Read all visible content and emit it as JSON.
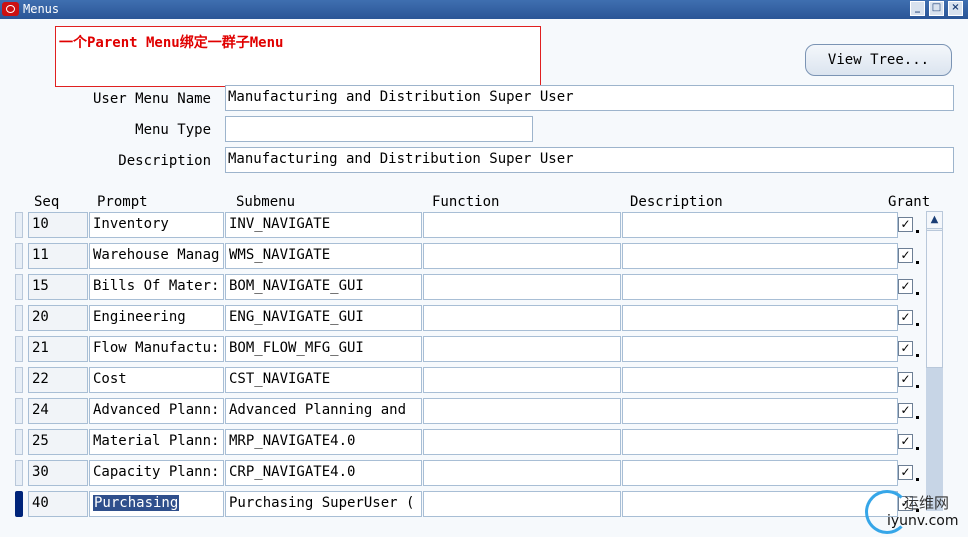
{
  "window": {
    "title": "Menus"
  },
  "note": {
    "text": "一个Parent Menu绑定一群子Menu"
  },
  "view_tree_label": "View Tree...",
  "form": {
    "user_menu_name_label": "User Menu Name",
    "user_menu_name_value": "Manufacturing and Distribution Super User",
    "menu_type_label": "Menu Type",
    "menu_type_value": "",
    "description_label": "Description",
    "description_value": "Manufacturing and Distribution Super User"
  },
  "table": {
    "headers": {
      "seq": "Seq",
      "prompt": "Prompt",
      "submenu": "Submenu",
      "function": "Function",
      "description": "Description",
      "grant": "Grant"
    },
    "rows": [
      {
        "seq": "10",
        "prompt": "Inventory",
        "submenu": "INV_NAVIGATE",
        "function": "",
        "description": "",
        "grant": true
      },
      {
        "seq": "11",
        "prompt": "Warehouse Manag",
        "submenu": "WMS_NAVIGATE",
        "function": "",
        "description": "",
        "grant": true
      },
      {
        "seq": "15",
        "prompt": "Bills Of Mater:",
        "submenu": "BOM_NAVIGATE_GUI",
        "function": "",
        "description": "",
        "grant": true
      },
      {
        "seq": "20",
        "prompt": "Engineering",
        "submenu": "ENG_NAVIGATE_GUI",
        "function": "",
        "description": "",
        "grant": true
      },
      {
        "seq": "21",
        "prompt": "Flow Manufactu:",
        "submenu": "BOM_FLOW_MFG_GUI",
        "function": "",
        "description": "",
        "grant": true
      },
      {
        "seq": "22",
        "prompt": "Cost",
        "submenu": "CST_NAVIGATE",
        "function": "",
        "description": "",
        "grant": true
      },
      {
        "seq": "24",
        "prompt": "Advanced Plann:",
        "submenu": "Advanced Planning and",
        "function": "",
        "description": "",
        "grant": true
      },
      {
        "seq": "25",
        "prompt": "Material Plann:",
        "submenu": "MRP_NAVIGATE4.0",
        "function": "",
        "description": "",
        "grant": true
      },
      {
        "seq": "30",
        "prompt": "Capacity Plann:",
        "submenu": "CRP_NAVIGATE4.0",
        "function": "",
        "description": "",
        "grant": true
      },
      {
        "seq": "40",
        "prompt": "Purchasing",
        "submenu": "Purchasing SuperUser (",
        "function": "",
        "description": "",
        "grant": true
      }
    ]
  },
  "watermark": {
    "cn": "运维网",
    "url": "iyunv.com"
  },
  "icons": {
    "app": "oracle-logo-icon",
    "check": "check-icon"
  },
  "colors": {
    "titlebar": "#2a5596",
    "note_border": "#e02020",
    "selection": "#2f4f8c"
  }
}
